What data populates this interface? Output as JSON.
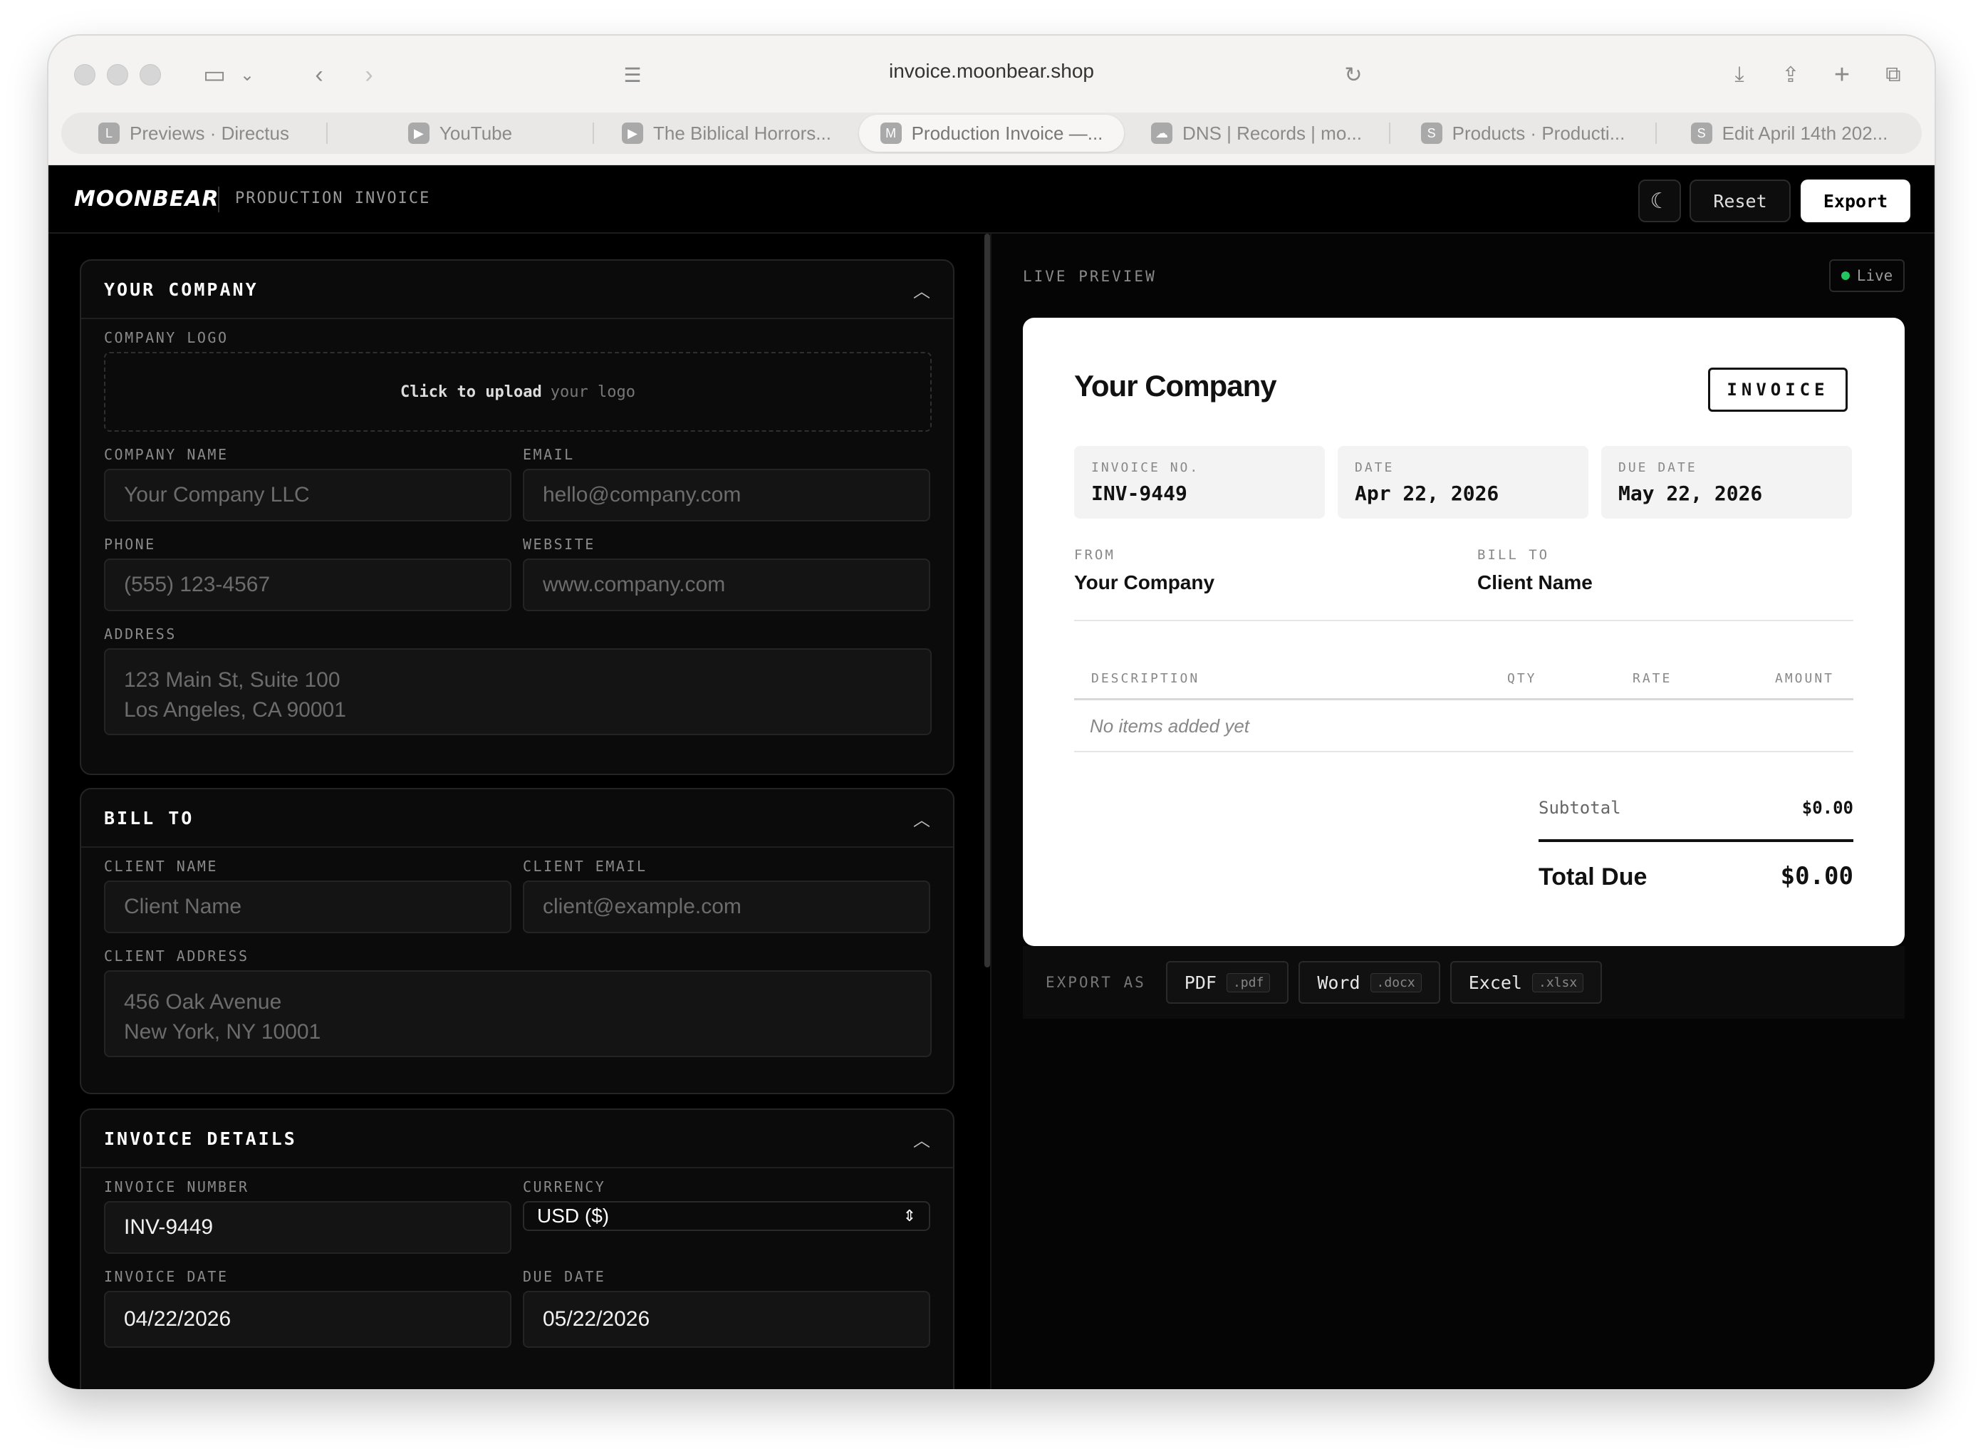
{
  "browser": {
    "url": "invoice.moonbear.shop",
    "tabs": [
      {
        "label": "Previews · Directus",
        "fav": "L"
      },
      {
        "label": "YouTube",
        "fav": "▶"
      },
      {
        "label": "The Biblical Horrors...",
        "fav": "▶"
      },
      {
        "label": "Production Invoice —...",
        "fav": "M",
        "active": true
      },
      {
        "label": "DNS | Records | mo...",
        "fav": "☁"
      },
      {
        "label": "Products · Producti...",
        "fav": "S"
      },
      {
        "label": "Edit April 14th 202...",
        "fav": "S"
      }
    ]
  },
  "header": {
    "brand": "MOONBEAR",
    "title": "PRODUCTION INVOICE",
    "reset_label": "Reset",
    "export_label": "Export"
  },
  "company": {
    "title": "YOUR COMPANY",
    "logo_label": "COMPANY LOGO",
    "upload_strong": "Click to upload",
    "upload_weak": "your logo",
    "name_label": "COMPANY NAME",
    "name_placeholder": "Your Company LLC",
    "email_label": "EMAIL",
    "email_placeholder": "hello@company.com",
    "phone_label": "PHONE",
    "phone_placeholder": "(555) 123-4567",
    "website_label": "WEBSITE",
    "website_placeholder": "www.company.com",
    "address_label": "ADDRESS",
    "address_line1": "123 Main St, Suite 100",
    "address_line2": "Los Angeles, CA 90001"
  },
  "bill_to": {
    "title": "BILL TO",
    "client_name_label": "CLIENT NAME",
    "client_name_placeholder": "Client Name",
    "client_email_label": "CLIENT EMAIL",
    "client_email_placeholder": "client@example.com",
    "client_address_label": "CLIENT ADDRESS",
    "address_line1": "456 Oak Avenue",
    "address_line2": "New York, NY 10001"
  },
  "details": {
    "title": "INVOICE DETAILS",
    "number_label": "INVOICE NUMBER",
    "number_value": "INV-9449",
    "currency_label": "CURRENCY",
    "currency_value": "USD ($)",
    "date_label": "INVOICE DATE",
    "date_value": "04/22/2026",
    "due_label": "DUE DATE",
    "due_value": "05/22/2026"
  },
  "preview": {
    "label": "LIVE PREVIEW",
    "badge": "Live",
    "company": "Your Company",
    "tag": "INVOICE",
    "meta": [
      {
        "key": "INVOICE NO.",
        "value": "INV-9449"
      },
      {
        "key": "DATE",
        "value": "Apr 22, 2026"
      },
      {
        "key": "DUE DATE",
        "value": "May 22, 2026"
      }
    ],
    "from_label": "FROM",
    "from_value": "Your Company",
    "billto_label": "BILL TO",
    "billto_value": "Client Name",
    "columns": [
      "DESCRIPTION",
      "QTY",
      "RATE",
      "AMOUNT"
    ],
    "empty": "No items added yet",
    "subtotal_label": "Subtotal",
    "subtotal_value": "$0.00",
    "total_label": "Total Due",
    "total_value": "$0.00"
  },
  "export": {
    "label": "EXPORT AS",
    "buttons": [
      {
        "label": "PDF",
        "ext": ".pdf"
      },
      {
        "label": "Word",
        "ext": ".docx"
      },
      {
        "label": "Excel",
        "ext": ".xlsx"
      }
    ]
  },
  "colors": {
    "accent_live": "#22c55e",
    "background": "#000000",
    "paper": "#ffffff"
  }
}
